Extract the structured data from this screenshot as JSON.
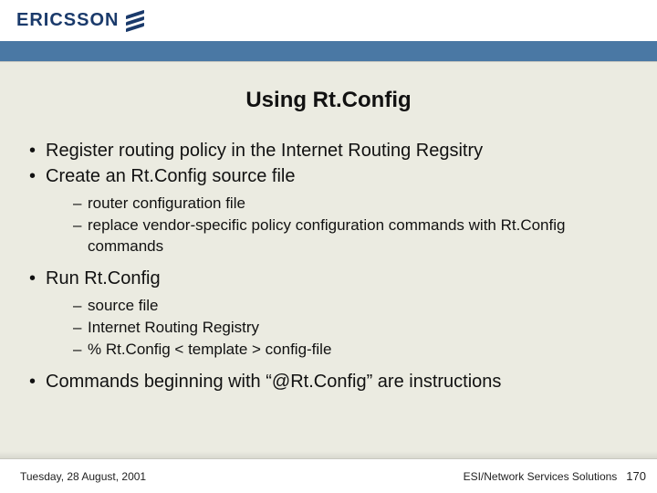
{
  "brand": {
    "name": "ERICSSON"
  },
  "title": "Using Rt.Config",
  "bullets": {
    "b1": "Register routing policy in the Internet Routing Regsitry",
    "b2": "Create an Rt.Config source file",
    "b2_sub": {
      "s1": "router configuration file",
      "s2": "replace vendor-specific policy configuration commands with Rt.Config commands"
    },
    "b3": "Run Rt.Config",
    "b3_sub": {
      "s1": "source file",
      "s2": "Internet Routing Registry",
      "s3": "% Rt.Config < template > config-file"
    },
    "b4": "Commands beginning with “@Rt.Config” are instructions"
  },
  "footer": {
    "date": "Tuesday, 28 August, 2001",
    "org": "ESI/Network Services Solutions",
    "page": "170"
  }
}
